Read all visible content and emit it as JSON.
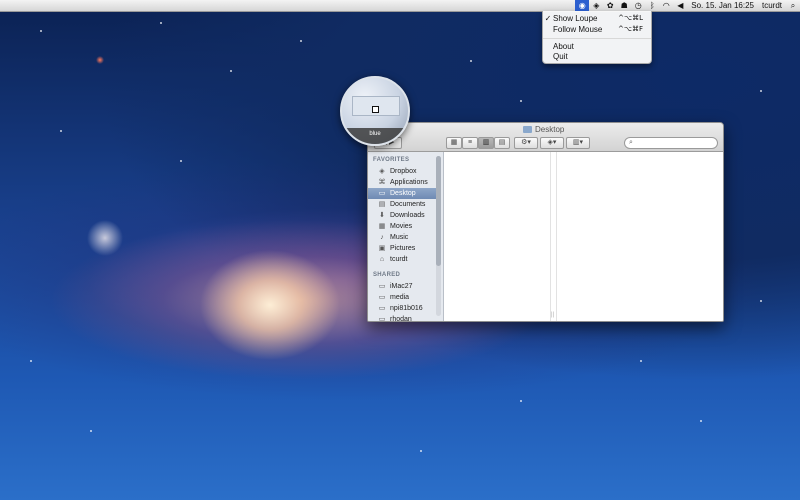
{
  "menubar": {
    "clock": "So. 15. Jan  16:25",
    "user": "tcurdt",
    "icons": [
      "loupe-app-icon",
      "dropbox-icon",
      "paw-icon",
      "alien-icon",
      "time-machine-icon",
      "bluetooth-icon",
      "wifi-icon",
      "volume-icon",
      "spotlight-icon"
    ]
  },
  "dropdown": {
    "items": [
      {
        "check": "✓",
        "label": "Show Loupe",
        "shortcut": "^⌥⌘L"
      },
      {
        "check": "",
        "label": "Follow Mouse",
        "shortcut": "^⌥⌘F"
      },
      {
        "check": "",
        "label": "About",
        "shortcut": ""
      },
      {
        "check": "",
        "label": "Quit",
        "shortcut": ""
      }
    ]
  },
  "loupe": {
    "label": "blue"
  },
  "finder": {
    "title": "Desktop",
    "search_placeholder": "",
    "sidebar": {
      "favorites_header": "FAVORITES",
      "favorites": [
        {
          "label": "Dropbox",
          "icon": "dropbox-icon",
          "glyph": "◈"
        },
        {
          "label": "Applications",
          "icon": "applications-icon",
          "glyph": "⌘"
        },
        {
          "label": "Desktop",
          "icon": "desktop-icon",
          "glyph": "▭"
        },
        {
          "label": "Documents",
          "icon": "documents-icon",
          "glyph": "▤"
        },
        {
          "label": "Downloads",
          "icon": "downloads-icon",
          "glyph": "⬇"
        },
        {
          "label": "Movies",
          "icon": "movies-icon",
          "glyph": "▦"
        },
        {
          "label": "Music",
          "icon": "music-icon",
          "glyph": "♪"
        },
        {
          "label": "Pictures",
          "icon": "pictures-icon",
          "glyph": "▣"
        },
        {
          "label": "tcurdt",
          "icon": "home-icon",
          "glyph": "⌂"
        }
      ],
      "shared_header": "SHARED",
      "shared": [
        {
          "label": "iMac27",
          "icon": "computer-icon",
          "glyph": "▭"
        },
        {
          "label": "media",
          "icon": "computer-icon",
          "glyph": "▭"
        },
        {
          "label": "npi81b016",
          "icon": "computer-icon",
          "glyph": "▭"
        },
        {
          "label": "rhodan",
          "icon": "computer-icon",
          "glyph": "▭"
        }
      ]
    }
  }
}
